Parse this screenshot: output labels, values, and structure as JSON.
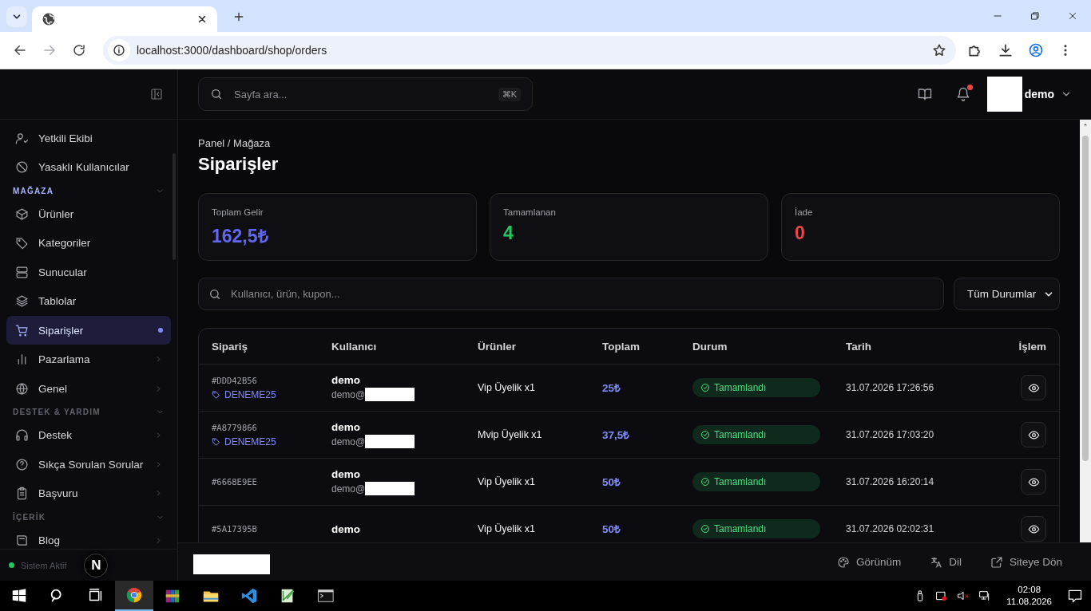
{
  "browser": {
    "url": "localhost:3000/dashboard/shop/orders",
    "nav": [
      {
        "kind": "back",
        "disabled": false
      },
      {
        "kind": "forward",
        "disabled": true
      },
      {
        "kind": "reload",
        "disabled": false
      }
    ]
  },
  "sidebar": {
    "sections": [
      {
        "items": [
          {
            "label": "Yetkili Ekibi",
            "selected": false
          },
          {
            "label": "Yasaklı Kullanıcılar",
            "selected": false
          }
        ]
      },
      {
        "title": "MAĞAZA",
        "highlighted": true,
        "expanded": true,
        "items": [
          {
            "label": "Ürünler",
            "selected": false
          },
          {
            "label": "Kategoriler",
            "selected": false
          },
          {
            "label": "Sunucular",
            "selected": false
          },
          {
            "label": "Tablolar",
            "selected": false
          },
          {
            "label": "Siparişler",
            "selected": true
          },
          {
            "label": "Pazarlama",
            "selected": false,
            "expanded": false
          },
          {
            "label": "Genel",
            "selected": false,
            "expanded": false
          }
        ]
      },
      {
        "title": "DESTEK & YARDIM",
        "highlighted": false,
        "expanded": true,
        "items": [
          {
            "label": "Destek",
            "selected": false,
            "expanded": false
          },
          {
            "label": "Sıkça Sorulan Sorular",
            "selected": false,
            "expanded": false
          },
          {
            "label": "Başvuru",
            "selected": false,
            "expanded": false
          }
        ]
      },
      {
        "title": "İÇERİK",
        "highlighted": false,
        "expanded": true,
        "items": [
          {
            "label": "Blog",
            "selected": false,
            "expanded": false
          }
        ]
      }
    ],
    "status": {
      "label": "Sistem Aktif",
      "online": true
    },
    "dev_badge": {
      "label": "N"
    }
  },
  "topbar": {
    "search": {
      "placeholder": "Sayfa ara...",
      "shortcut": "⌘K"
    },
    "notifications_unread": true,
    "user": {
      "name": "demo"
    }
  },
  "breadcrumb": "Panel / Mağaza",
  "title": "Siparişler",
  "stats": [
    {
      "label": "Toplam Gelir",
      "value": "162,5₺",
      "color": "#6366f1"
    },
    {
      "label": "Tamamlanan",
      "value": "4",
      "color": "#22c55e"
    },
    {
      "label": "İade",
      "value": "0",
      "color": "#ef4444"
    }
  ],
  "filter": {
    "search": {
      "placeholder": "Kullanıcı, ürün, kupon..."
    },
    "status_select": {
      "value": "Tüm Durumlar"
    }
  },
  "table": {
    "columns": [
      "Sipariş",
      "Kullanıcı",
      "Ürünler",
      "Toplam",
      "Durum",
      "Tarih",
      "İşlem"
    ],
    "rows": [
      {
        "order": "#DDD42B56",
        "coupon": "DENEME25",
        "user": "demo",
        "email": "demo@",
        "product": "Vip Üyelik x1",
        "total": "25₺",
        "status": {
          "label": "Tamamlandı",
          "kind": "completed"
        },
        "date": "31.07.2026 17:26:56"
      },
      {
        "order": "#A8779866",
        "coupon": "DENEME25",
        "user": "demo",
        "email": "demo@",
        "product": "Mvip Üyelik x1",
        "total": "37,5₺",
        "status": {
          "label": "Tamamlandı",
          "kind": "completed"
        },
        "date": "31.07.2026 17:03:20"
      },
      {
        "order": "#6668E9EE",
        "user": "demo",
        "email": "demo@",
        "product": "Vip Üyelik x1",
        "total": "50₺",
        "status": {
          "label": "Tamamlandı",
          "kind": "completed"
        },
        "date": "31.07.2026 16:20:14"
      },
      {
        "order": "#5A17395B",
        "user": "demo",
        "product": "Vip Üyelik x1",
        "total": "50₺",
        "status": {
          "label": "Tamamlandı",
          "kind": "completed"
        },
        "date": "31.07.2026 02:02:31"
      }
    ]
  },
  "footer": {
    "links": [
      "Görünüm",
      "Dil",
      "Siteye Dön"
    ]
  },
  "taskbar": {
    "apps": [
      {
        "kind": "chrome",
        "active": true
      },
      {
        "kind": "archive",
        "active": false
      },
      {
        "kind": "folder",
        "active": false
      },
      {
        "kind": "code",
        "active": false
      },
      {
        "kind": "notepad",
        "active": false
      },
      {
        "kind": "terminal",
        "active": false
      }
    ],
    "clock": {
      "time": "02:08",
      "date": "11.08.2026"
    }
  }
}
